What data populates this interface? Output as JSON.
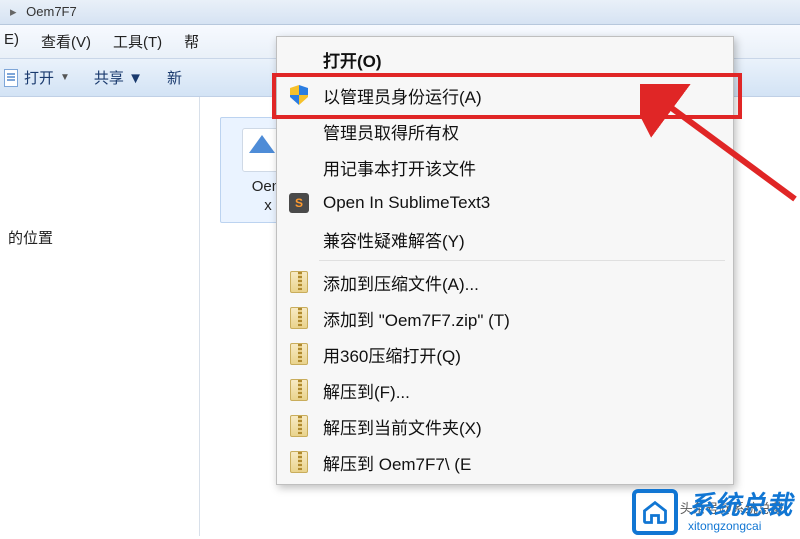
{
  "titlebar": {
    "path": "Oem7F7"
  },
  "menubar": {
    "edit": "E)",
    "view": "查看(V)",
    "tools": "工具(T)",
    "help": "帮"
  },
  "toolbar": {
    "open_icon_label": "打开",
    "share": "共享 ▼",
    "new": "新"
  },
  "nav": {
    "recent_label": "的位置"
  },
  "file": {
    "name_line1": "Oem",
    "name_line2": "x"
  },
  "context_menu": {
    "open": "打开(O)",
    "run_as_admin": "以管理员身份运行(A)",
    "admin_take_ownership": "管理员取得所有权",
    "open_with_notepad": "用记事本打开该文件",
    "open_in_sublime": "Open In SublimeText3",
    "troubleshoot": "兼容性疑难解答(Y)",
    "add_to_archive": "添加到压缩文件(A)...",
    "add_to_zip": "添加到 \"Oem7F7.zip\" (T)",
    "open_with_360zip": "用360压缩打开(Q)",
    "extract_to": "解压到(F)...",
    "extract_here": "解压到当前文件夹(X)",
    "extract_to_folder": "解压到 Oem7F7\\ (E"
  },
  "watermark": {
    "title": "系统总裁",
    "url": "xitongzongcai",
    "credit": "头条号@系统总裁"
  }
}
